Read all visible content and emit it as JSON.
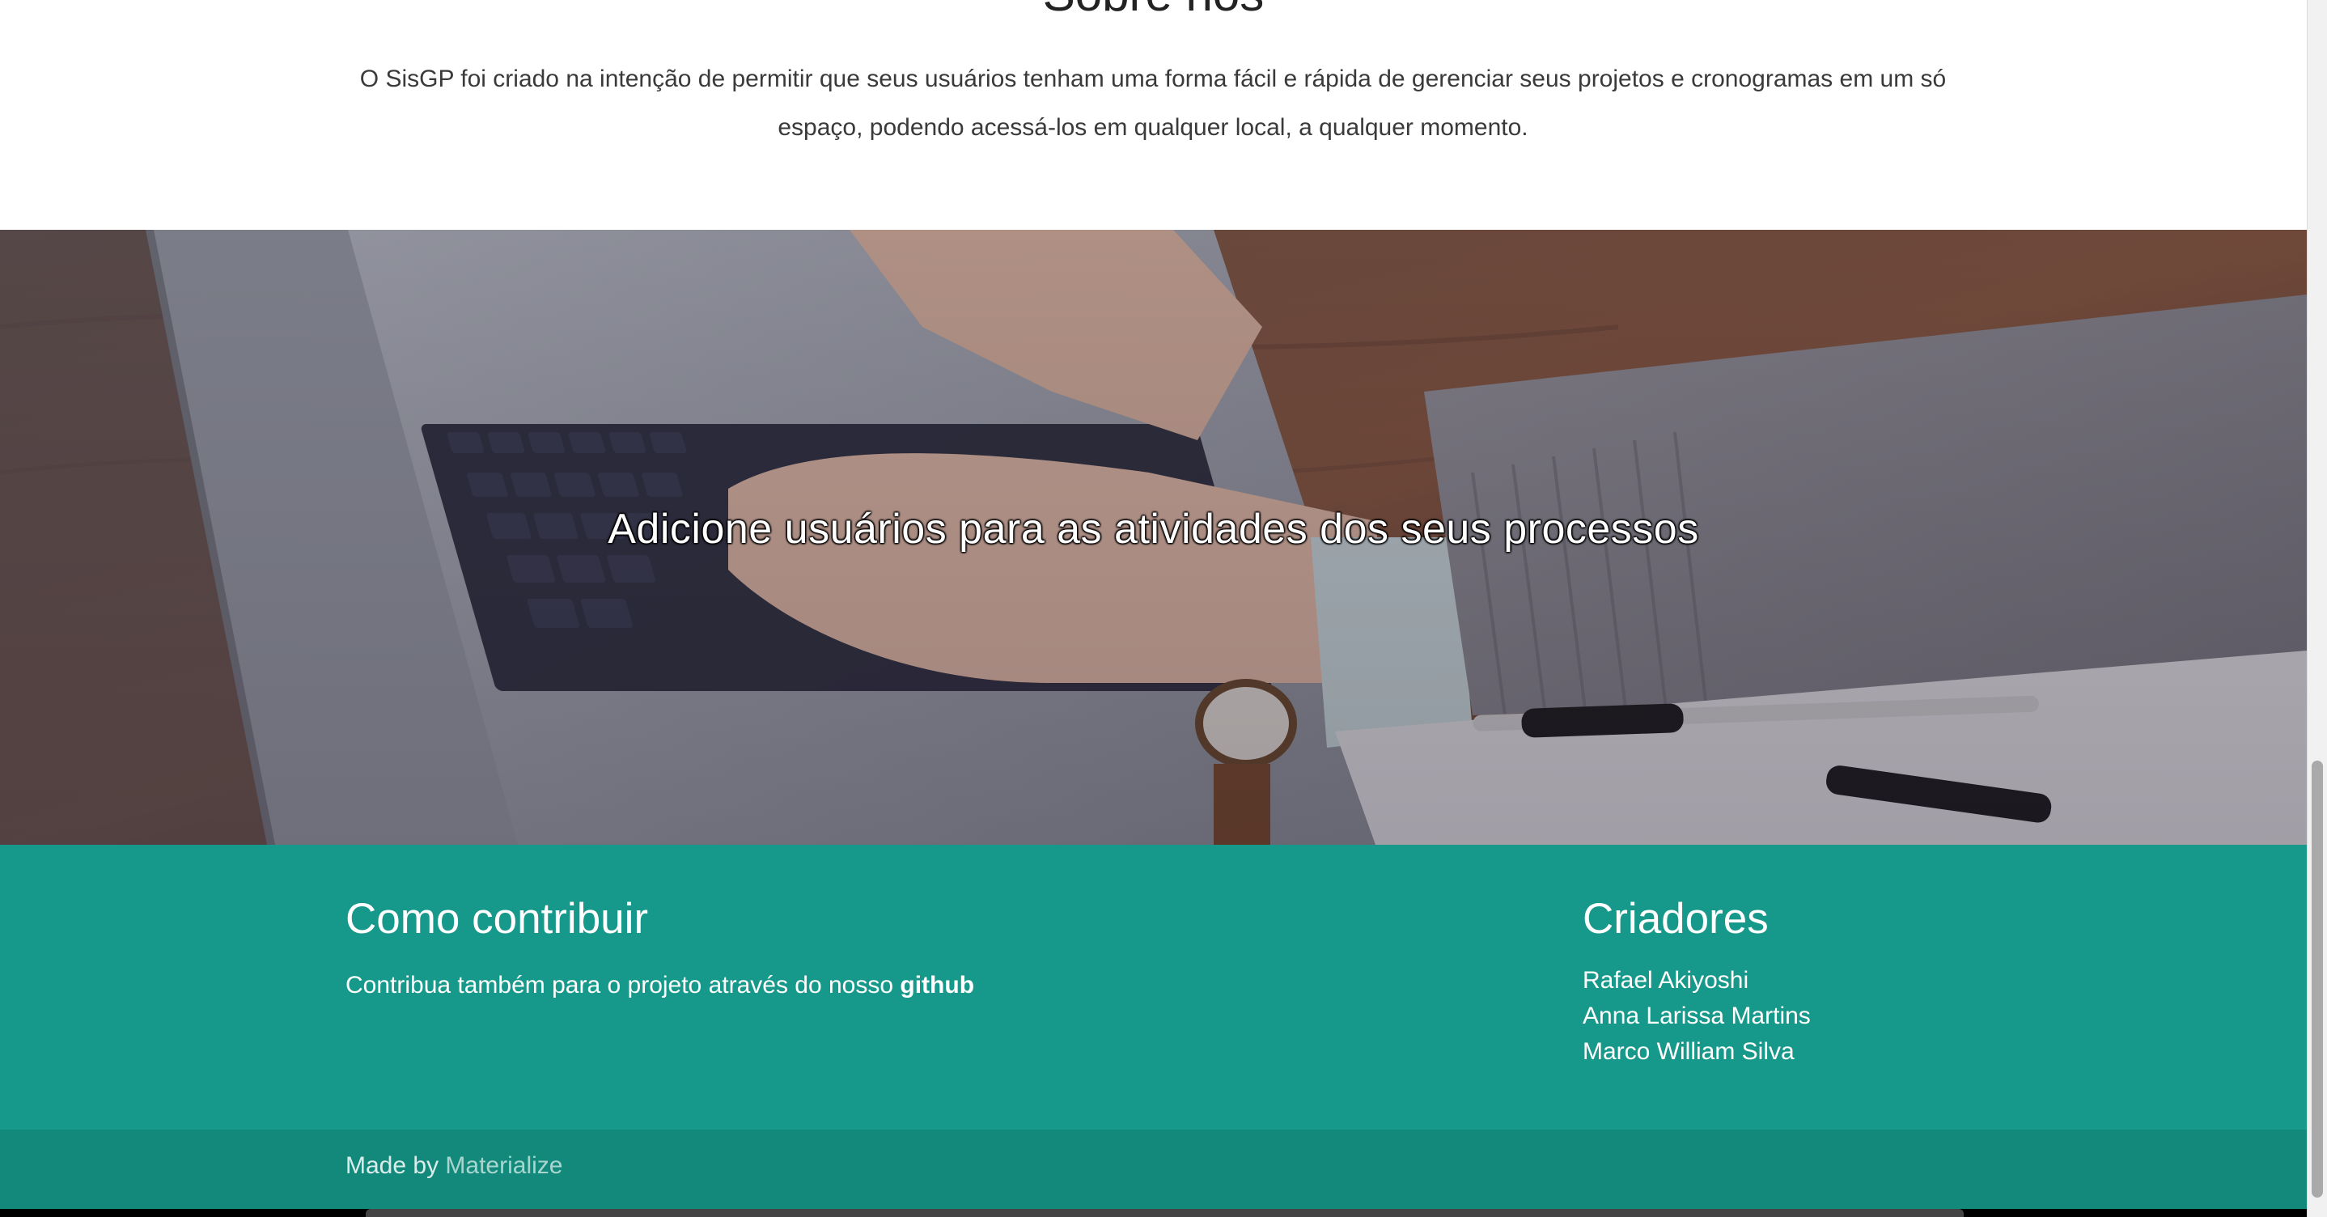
{
  "about": {
    "title": "Sobre nós",
    "text": "O SisGP foi criado na intenção de permitir que seus usuários tenham uma forma fácil e rápida de gerenciar seus projetos e cronogramas em um só espaço, podendo acessá-los em qualquer local, a qualquer momento."
  },
  "hero": {
    "caption": "Adicione usuários para as atividades dos seus processos",
    "image": "laptop-typing-photo"
  },
  "footer": {
    "contribute": {
      "heading": "Como contribuir",
      "text_prefix": "Contribua também para o projeto através do nosso ",
      "link_label": "github"
    },
    "creators": {
      "heading": "Criadores",
      "names": [
        "Rafael Akiyoshi",
        "Anna Larissa Martins",
        "Marco William Silva"
      ]
    },
    "copyright": {
      "prefix": "Made by ",
      "link_label": "Materialize"
    }
  },
  "colors": {
    "footer_bg": "#16998a",
    "copyright_bg": "#13897c",
    "link_muted": "#a8d6cf"
  }
}
